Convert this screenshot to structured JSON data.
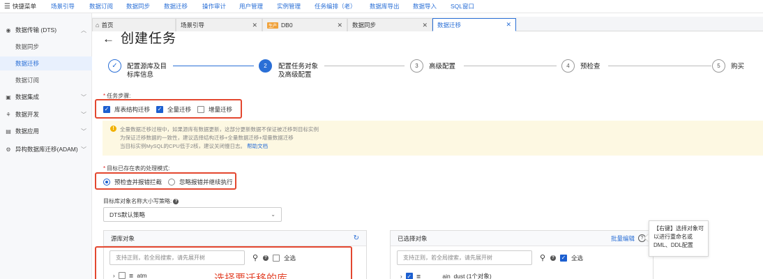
{
  "topbar": {
    "menu_label": "快捷菜单",
    "items": [
      "场景引导",
      "数据订阅",
      "数据同步",
      "数据迁移",
      "操作审计",
      "用户管理",
      "实例管理",
      "任务编排（老）",
      "数据库导出",
      "数据导入",
      "SQL窗口"
    ]
  },
  "sidebar": {
    "section_dts": "数据传输 (DTS)",
    "sub_sync": "数据同步",
    "sub_migration": "数据迁移",
    "sub_subscription": "数据订阅",
    "integration": "数据集成",
    "development": "数据开发",
    "application": "数据应用",
    "adam": "异构数据库迁移(ADAM)"
  },
  "tabs": [
    {
      "label": "首页",
      "env": ""
    },
    {
      "label": "场景引导",
      "env": ""
    },
    {
      "label": "DB0",
      "env": "生产"
    },
    {
      "label": "数据同步",
      "env": ""
    },
    {
      "label": "数据迁移",
      "env": ""
    }
  ],
  "page": {
    "title": "创建任务"
  },
  "steps": [
    {
      "number": "✓",
      "line1": "配置源库及目",
      "line2": "标库信息",
      "state": "done"
    },
    {
      "number": "2",
      "line1": "配置任务对象",
      "line2": "及高级配置",
      "state": "current"
    },
    {
      "number": "3",
      "line1": "高级配置",
      "line2": "",
      "state": "todo"
    },
    {
      "number": "4",
      "line1": "预检查",
      "line2": "",
      "state": "todo"
    },
    {
      "number": "5",
      "line1": "购买",
      "line2": "",
      "state": "todo"
    }
  ],
  "task_steps": {
    "label": "任务步骤:",
    "options": [
      {
        "label": "库表结构迁移",
        "checked": true
      },
      {
        "label": "全量迁移",
        "checked": true
      },
      {
        "label": "增量迁移",
        "checked": false
      }
    ]
  },
  "notice": {
    "line1": "全量数据迁移过程中，如果源库有数据更新，这部分更新数据不保证被迁移到目标实例",
    "line2": "为保证迁移数据的一致性，建议选择结构迁移+全量数据迁移+增量数据迁移",
    "line3": "当目标实例MySQL的CPU低于2核，建议关闭慢日志。",
    "help_link": "帮助文档"
  },
  "conflict_mode": {
    "label": "目标已存在表的处理模式:",
    "options": [
      {
        "label": "预检查并报错拦截",
        "selected": true
      },
      {
        "label": "忽略报错并继续执行",
        "selected": false
      }
    ]
  },
  "case_policy": {
    "label": "目标库对象名称大小写策略:",
    "value": "DTS默认策略"
  },
  "source_panel": {
    "title": "源库对象",
    "search_placeholder": "支持正则，若全局搜索，请先展开树",
    "select_all": "全选",
    "rows": [
      {
        "name": "atm",
        "checked": false
      }
    ]
  },
  "selected_panel": {
    "title": "已选择对象",
    "batch_edit": "批量编辑",
    "search_placeholder": "支持正则，若全局搜索，请先展开树",
    "select_all": "全选",
    "rows": [
      {
        "name": "ain_dust (1个对象)",
        "checked": true
      }
    ]
  },
  "annotation": "选择要迁移的库",
  "tooltip": "【右键】选择对象可以进行重命名或DML、DDL配置",
  "colors": {
    "accent": "#2a6fd6",
    "annotation": "#e3472f",
    "notice_bg": "#fdf8e2"
  }
}
